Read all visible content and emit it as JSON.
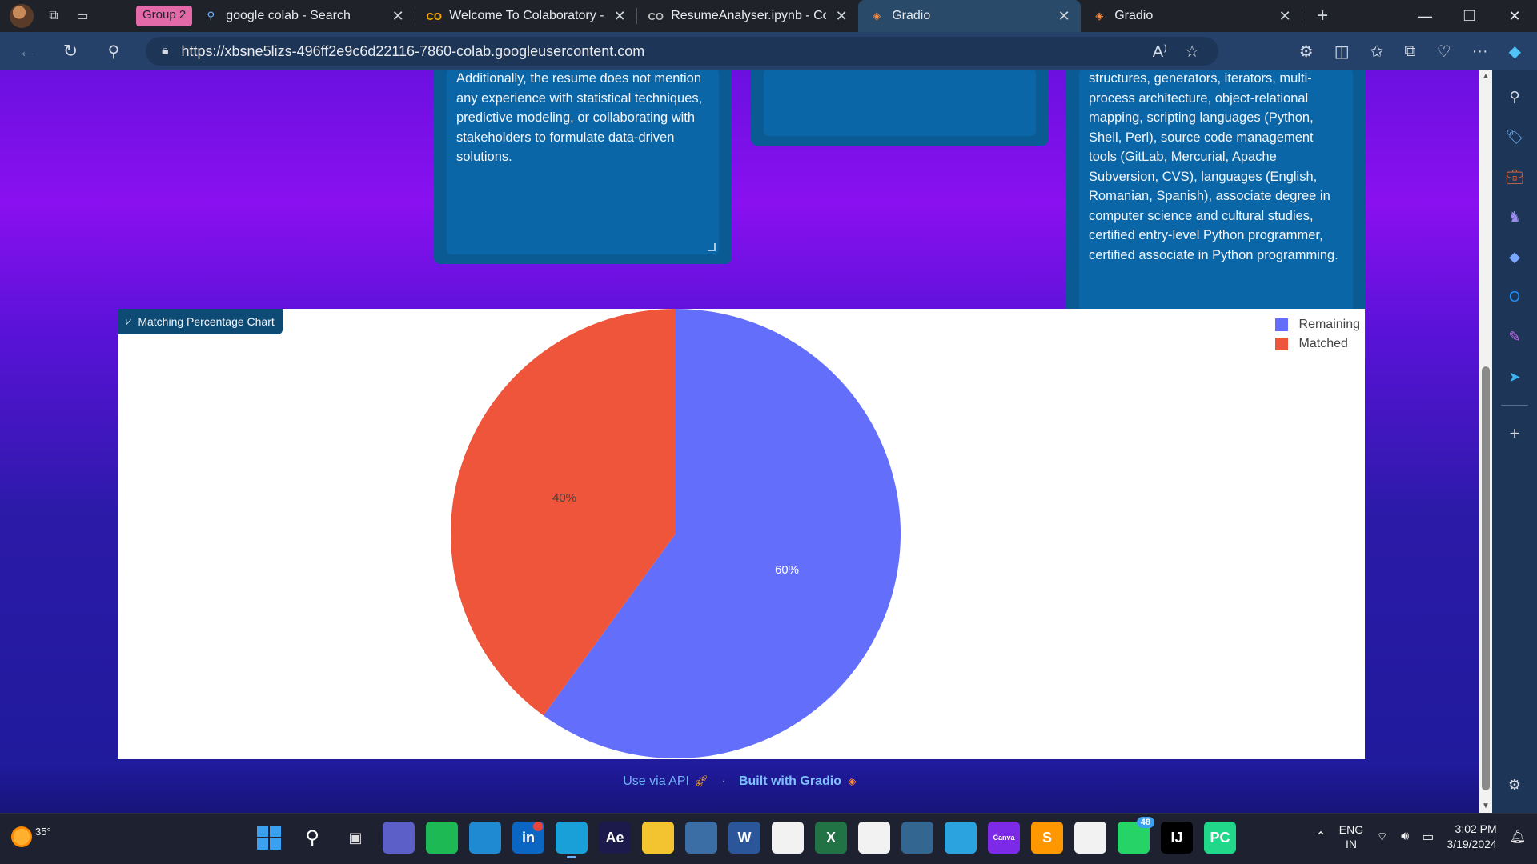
{
  "browser": {
    "group_chip": "Group 2",
    "tabs": [
      {
        "title": "google colab - Search",
        "favicon": "search-icon",
        "active": false
      },
      {
        "title": "Welcome To Colaboratory - Co",
        "favicon": "colab-icon",
        "active": false
      },
      {
        "title": "ResumeAnalyser.ipynb - Colab",
        "favicon": "colab-icon",
        "active": false
      },
      {
        "title": "Gradio",
        "favicon": "gradio-icon",
        "active": true
      },
      {
        "title": "Gradio",
        "favicon": "gradio-icon",
        "active": false
      }
    ],
    "url": "https://xbsne5lizs-496ff2e9c6d22116-7860-colab.googleusercontent.com"
  },
  "page": {
    "card_left_text": "Additionally, the resume does not mention any experience with statistical techniques, predictive modeling, or collaborating with stakeholders to formulate data-driven solutions.",
    "card_right_text": "structures, generators, iterators, multi-process architecture, object-relational mapping, scripting languages (Python, Shell, Perl), source code management tools (GitLab, Mercurial, Apache Subversion, CVS), languages (English, Romanian, Spanish), associate degree in computer science and cultural studies, certified entry-level Python programmer, certified associate in Python programming.",
    "chart_label": "Matching Percentage Chart",
    "footer": {
      "api_link": "Use via API",
      "separator": "·",
      "built_with": "Built with Gradio"
    }
  },
  "chart_data": {
    "type": "pie",
    "labels": [
      "Remaining",
      "Matched"
    ],
    "values": [
      60,
      40
    ],
    "text_labels": [
      "60%",
      "40%"
    ],
    "colors": [
      "#636efa",
      "#ef553b"
    ],
    "legend_position": "top-right"
  },
  "taskbar": {
    "weather_temp": "35°",
    "apps": [
      {
        "name": "windows-start",
        "label": "",
        "color": "#3aa0f0"
      },
      {
        "name": "search",
        "label": "",
        "color": "transparent"
      },
      {
        "name": "task-view",
        "label": "",
        "color": "transparent"
      },
      {
        "name": "teams-meet",
        "label": "",
        "color": "#5b5fc7"
      },
      {
        "name": "spotify",
        "label": "",
        "color": "#1db954"
      },
      {
        "name": "vscode",
        "label": "",
        "color": "#1f8ad2"
      },
      {
        "name": "linkedin",
        "label": "in",
        "color": "#0a66c2"
      },
      {
        "name": "edge",
        "label": "",
        "color": "#1aa0d8"
      },
      {
        "name": "after-effects",
        "label": "Ae",
        "color": "#1c1a4a"
      },
      {
        "name": "file-explorer",
        "label": "",
        "color": "#f4c430"
      },
      {
        "name": "mysql-workbench",
        "label": "",
        "color": "#3b6ea5"
      },
      {
        "name": "word",
        "label": "W",
        "color": "#2b579a"
      },
      {
        "name": "microsoft-store",
        "label": "",
        "color": "#f2f2f2"
      },
      {
        "name": "excel",
        "label": "X",
        "color": "#217346"
      },
      {
        "name": "mongodb",
        "label": "",
        "color": "#f2f2f2"
      },
      {
        "name": "postgresql",
        "label": "",
        "color": "#336791"
      },
      {
        "name": "telegram",
        "label": "",
        "color": "#2aa3df"
      },
      {
        "name": "canva",
        "label": "Canva",
        "color": "#7d2ae8"
      },
      {
        "name": "sublime-text",
        "label": "S",
        "color": "#ff9800"
      },
      {
        "name": "slack",
        "label": "",
        "color": "#f2f2f2"
      },
      {
        "name": "whatsapp",
        "label": "",
        "color": "#25d366"
      },
      {
        "name": "intellij",
        "label": "IJ",
        "color": "#000000"
      },
      {
        "name": "pycharm",
        "label": "PC",
        "color": "#21d789"
      }
    ],
    "whatsapp_badge": "48",
    "lang_line1": "ENG",
    "lang_line2": "IN",
    "time": "3:02 PM",
    "date": "3/19/2024"
  }
}
